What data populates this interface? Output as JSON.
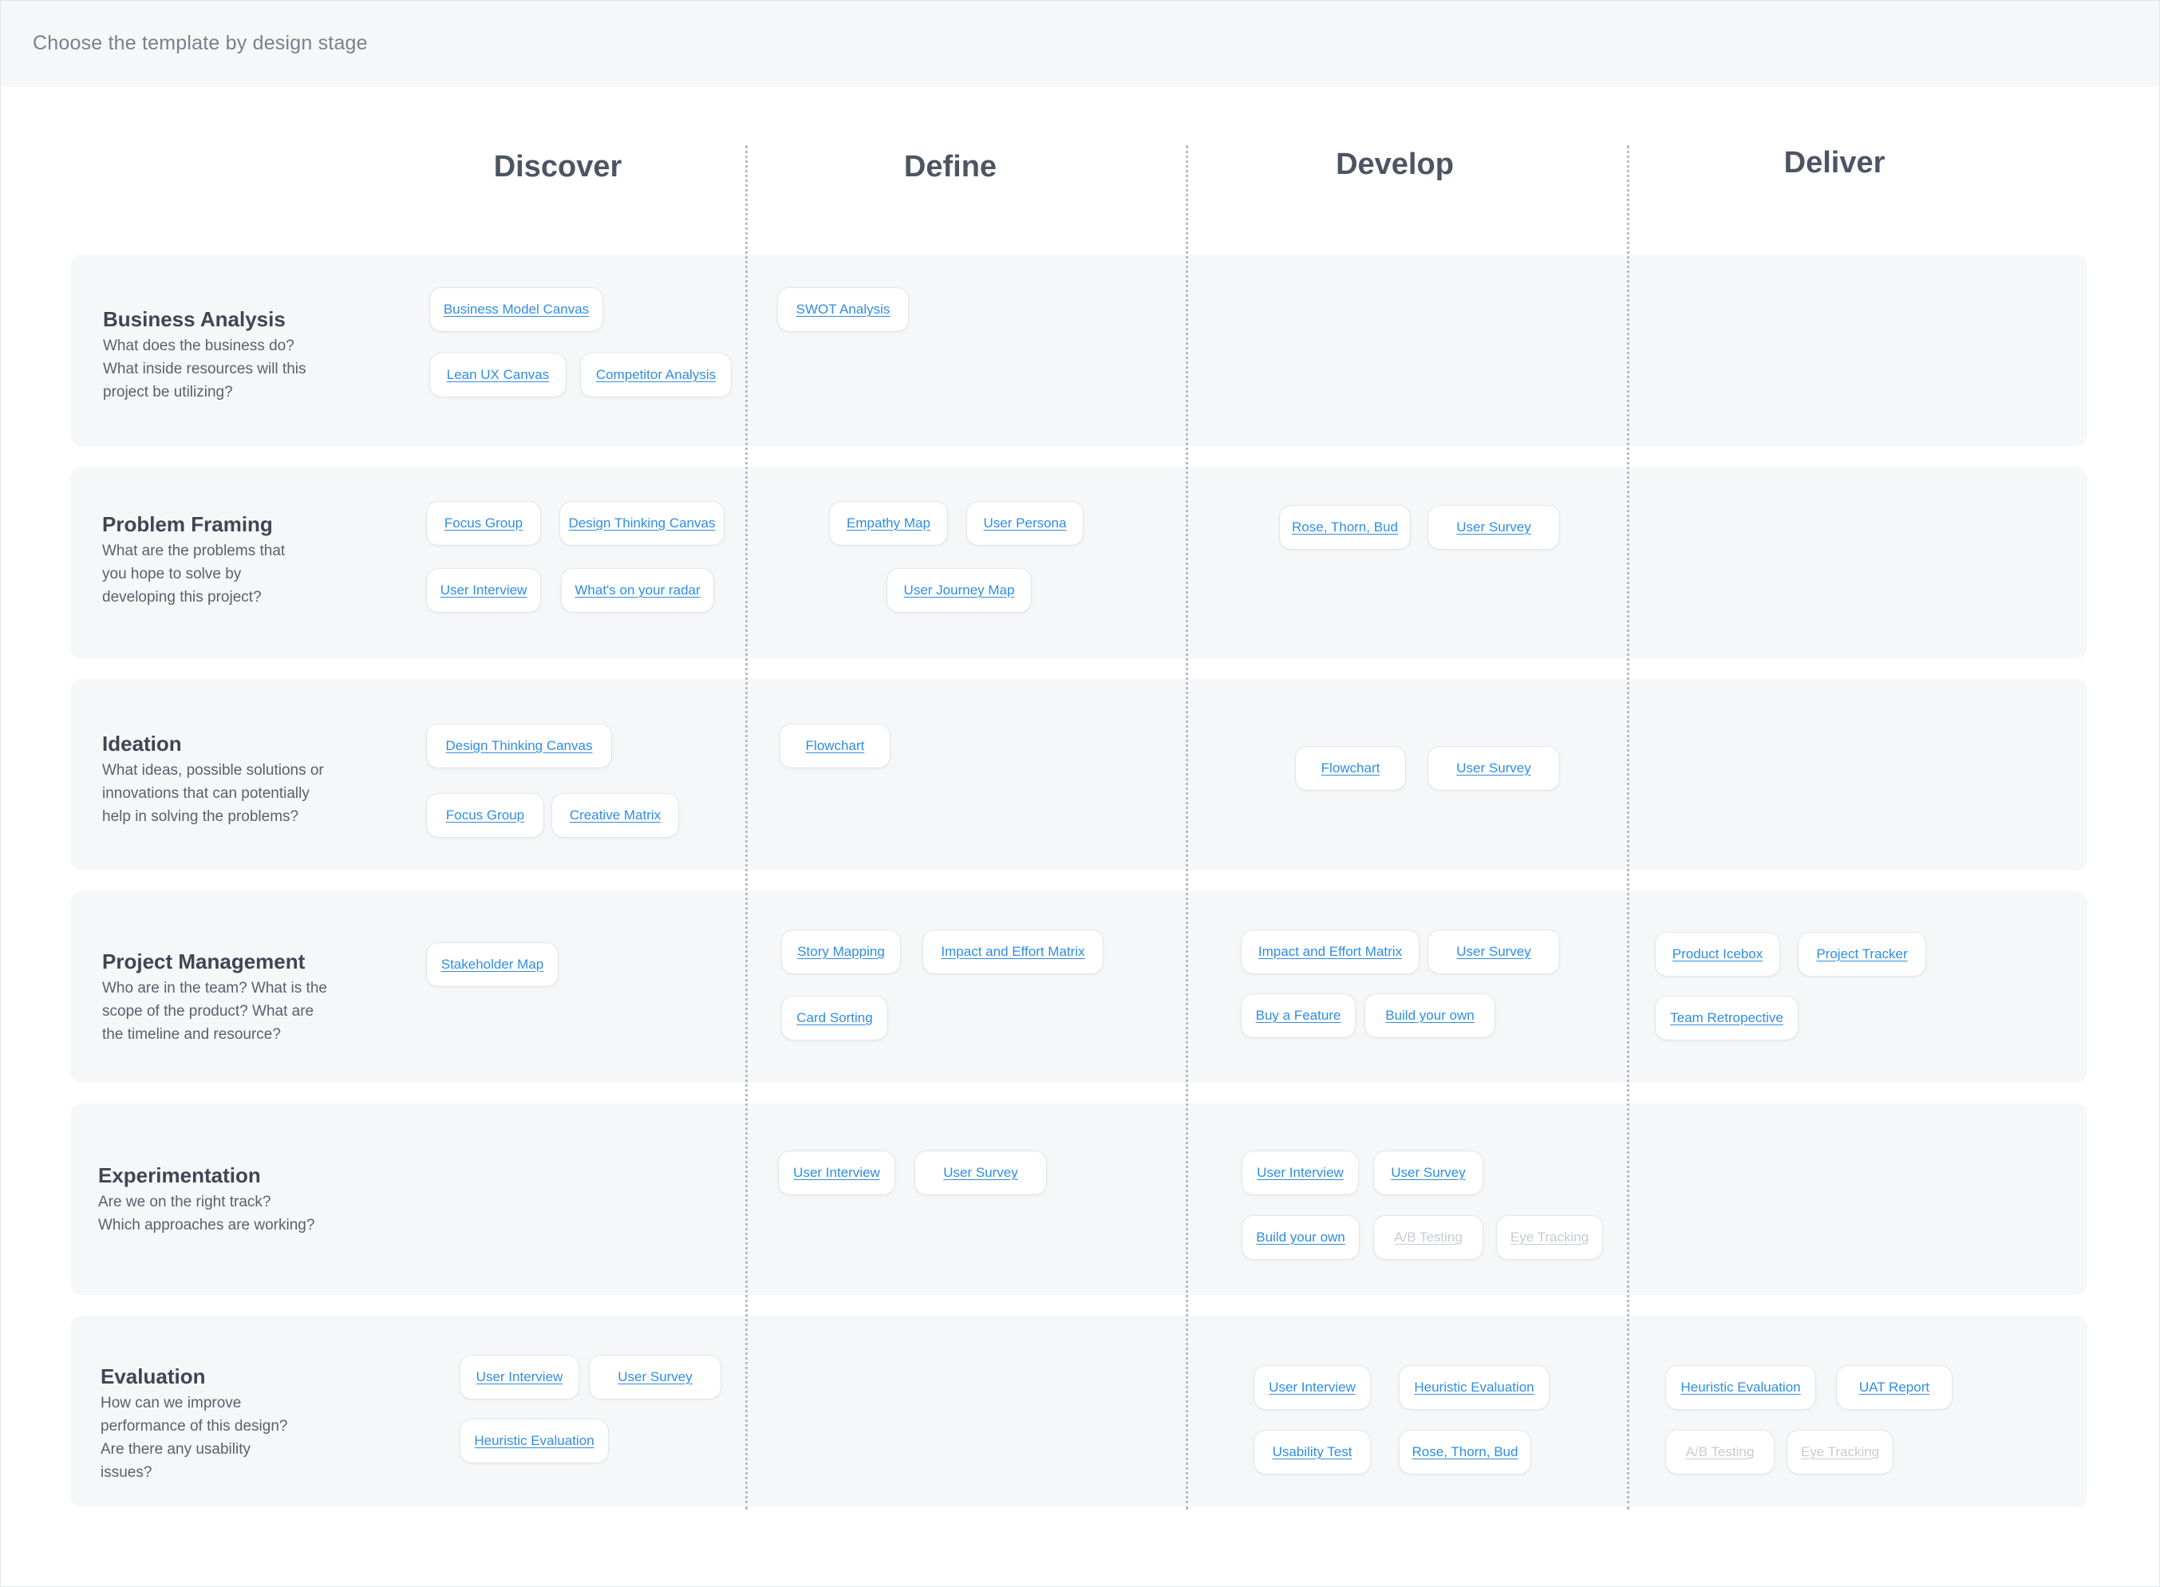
{
  "header": {
    "title": "Choose the template by design stage"
  },
  "columns": [
    "Discover",
    "Define",
    "Develop",
    "Deliver"
  ],
  "rows": [
    {
      "title": "Business Analysis",
      "description": [
        "What does the business do?",
        "What inside resources will this",
        "project be utilizing?"
      ]
    },
    {
      "title": "Problem Framing",
      "description": [
        "What are the problems that",
        "you hope to solve by",
        "developing this project?"
      ]
    },
    {
      "title": "Ideation",
      "description": [
        "What ideas, possible solutions or",
        "innovations that can potentially",
        "help in solving the problems?"
      ]
    },
    {
      "title": "Project Management",
      "description": [
        "Who are in the team?  What is the",
        "scope of the product? What are",
        "the timeline and resource?"
      ]
    },
    {
      "title": "Experimentation",
      "description": [
        "Are we on the right track?",
        "Which approaches are working?"
      ]
    },
    {
      "title": "Evaluation",
      "description": [
        "How can we improve",
        "performance of this design?",
        "Are there any usability",
        "issues?"
      ]
    }
  ],
  "templates": [
    {
      "label": "Business Model Canvas",
      "row": "Business Analysis",
      "stage": "Discover",
      "enabled": true
    },
    {
      "label": "Lean UX Canvas",
      "row": "Business Analysis",
      "stage": "Discover",
      "enabled": true
    },
    {
      "label": "Competitor Analysis",
      "row": "Business Analysis",
      "stage": "Discover",
      "enabled": true
    },
    {
      "label": "SWOT Analysis",
      "row": "Business Analysis",
      "stage": "Define",
      "enabled": true
    },
    {
      "label": "Focus Group",
      "row": "Problem Framing",
      "stage": "Discover",
      "enabled": true
    },
    {
      "label": "Design Thinking Canvas",
      "row": "Problem Framing",
      "stage": "Discover",
      "enabled": true
    },
    {
      "label": "User Interview",
      "row": "Problem Framing",
      "stage": "Discover",
      "enabled": true
    },
    {
      "label": "What's on your radar",
      "row": "Problem Framing",
      "stage": "Discover",
      "enabled": true
    },
    {
      "label": "Empathy Map",
      "row": "Problem Framing",
      "stage": "Define",
      "enabled": true
    },
    {
      "label": "User Persona",
      "row": "Problem Framing",
      "stage": "Define",
      "enabled": true
    },
    {
      "label": "User Journey Map",
      "row": "Problem Framing",
      "stage": "Define",
      "enabled": true
    },
    {
      "label": "Rose, Thorn, Bud",
      "row": "Problem Framing",
      "stage": "Develop",
      "enabled": true
    },
    {
      "label": "User Survey",
      "row": "Problem Framing",
      "stage": "Develop",
      "enabled": true
    },
    {
      "label": "Design Thinking Canvas",
      "row": "Ideation",
      "stage": "Discover",
      "enabled": true
    },
    {
      "label": "Focus Group",
      "row": "Ideation",
      "stage": "Discover",
      "enabled": true
    },
    {
      "label": "Creative Matrix",
      "row": "Ideation",
      "stage": "Discover",
      "enabled": true
    },
    {
      "label": "Flowchart",
      "row": "Ideation",
      "stage": "Define",
      "enabled": true
    },
    {
      "label": "Flowchart",
      "row": "Ideation",
      "stage": "Develop",
      "enabled": true
    },
    {
      "label": "User Survey",
      "row": "Ideation",
      "stage": "Develop",
      "enabled": true
    },
    {
      "label": "Stakeholder Map",
      "row": "Project Management",
      "stage": "Discover",
      "enabled": true
    },
    {
      "label": "Story Mapping",
      "row": "Project Management",
      "stage": "Define",
      "enabled": true
    },
    {
      "label": "Impact and Effort Matrix",
      "row": "Project Management",
      "stage": "Define",
      "enabled": true
    },
    {
      "label": "Card Sorting",
      "row": "Project Management",
      "stage": "Define",
      "enabled": true
    },
    {
      "label": "Impact and Effort Matrix",
      "row": "Project Management",
      "stage": "Develop",
      "enabled": true
    },
    {
      "label": "User Survey",
      "row": "Project Management",
      "stage": "Develop",
      "enabled": true
    },
    {
      "label": "Buy a Feature",
      "row": "Project Management",
      "stage": "Develop",
      "enabled": true
    },
    {
      "label": "Build your own",
      "row": "Project Management",
      "stage": "Develop",
      "enabled": true
    },
    {
      "label": "Product Icebox",
      "row": "Project Management",
      "stage": "Deliver",
      "enabled": true
    },
    {
      "label": "Project Tracker",
      "row": "Project Management",
      "stage": "Deliver",
      "enabled": true
    },
    {
      "label": "Team Retropective",
      "row": "Project Management",
      "stage": "Deliver",
      "enabled": true
    },
    {
      "label": "User Interview",
      "row": "Experimentation",
      "stage": "Define",
      "enabled": true
    },
    {
      "label": "User Survey",
      "row": "Experimentation",
      "stage": "Define",
      "enabled": true
    },
    {
      "label": "User Interview",
      "row": "Experimentation",
      "stage": "Develop",
      "enabled": true
    },
    {
      "label": "User Survey",
      "row": "Experimentation",
      "stage": "Develop",
      "enabled": true
    },
    {
      "label": "Build your own",
      "row": "Experimentation",
      "stage": "Develop",
      "enabled": true
    },
    {
      "label": "A/B Testing",
      "row": "Experimentation",
      "stage": "Develop",
      "enabled": false
    },
    {
      "label": "Eye Tracking",
      "row": "Experimentation",
      "stage": "Develop",
      "enabled": false
    },
    {
      "label": "User Interview",
      "row": "Evaluation",
      "stage": "Discover",
      "enabled": true
    },
    {
      "label": "User Survey",
      "row": "Evaluation",
      "stage": "Discover",
      "enabled": true
    },
    {
      "label": "Heuristic Evaluation",
      "row": "Evaluation",
      "stage": "Discover",
      "enabled": true
    },
    {
      "label": "User Interview",
      "row": "Evaluation",
      "stage": "Develop",
      "enabled": true
    },
    {
      "label": "Heuristic Evaluation",
      "row": "Evaluation",
      "stage": "Develop",
      "enabled": true
    },
    {
      "label": "Usability Test",
      "row": "Evaluation",
      "stage": "Develop",
      "enabled": true
    },
    {
      "label": "Rose, Thorn, Bud",
      "row": "Evaluation",
      "stage": "Develop",
      "enabled": true
    },
    {
      "label": "Heuristic Evaluation",
      "row": "Evaluation",
      "stage": "Deliver",
      "enabled": true
    },
    {
      "label": "UAT Report",
      "row": "Evaluation",
      "stage": "Deliver",
      "enabled": true
    },
    {
      "label": "A/B Testing",
      "row": "Evaluation",
      "stage": "Deliver",
      "enabled": false
    },
    {
      "label": "Eye Tracking",
      "row": "Evaluation",
      "stage": "Deliver",
      "enabled": false
    }
  ],
  "colors": {
    "link": "#2f8de4",
    "disabled": "#c7cbd3",
    "row_background": "#f6f7f9"
  }
}
